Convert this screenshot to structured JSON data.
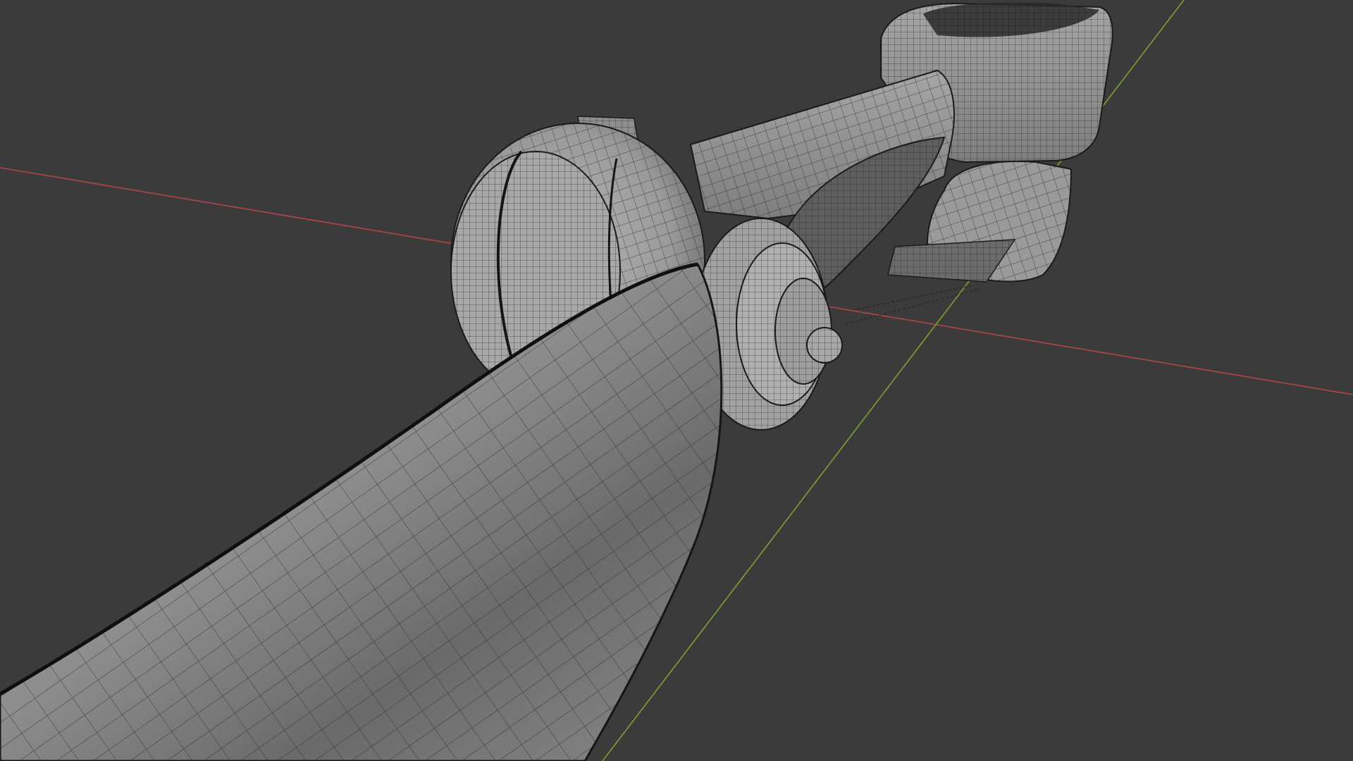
{
  "viewport": {
    "mode": "wireframe-overlay",
    "background_color": "#3b3b3b",
    "axes": {
      "x_axis_color": "#b0464a",
      "y_axis_color": "#7fa032"
    },
    "mesh": {
      "base_color": "#9c9c9c",
      "shadow_color": "#5e5e5e",
      "wire_color": "#1a1a1a"
    }
  }
}
